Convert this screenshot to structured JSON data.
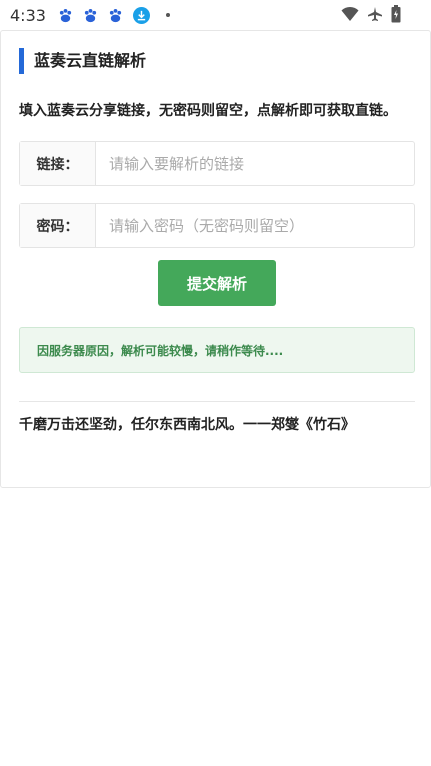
{
  "status_bar": {
    "time": "4:33",
    "left_icons": [
      "baidu-paw-icon",
      "baidu-paw-icon",
      "baidu-paw-icon",
      "download-icon",
      "dot-icon"
    ],
    "right_icons": [
      "wifi-icon",
      "airplane-icon",
      "battery-icon"
    ]
  },
  "card": {
    "title": "蓝奏云直链解析",
    "accent_color": "#2469d8",
    "intro": "填入蓝奏云分享链接，无密码则留空，点解析即可获取直链。",
    "link_field": {
      "label": "链接：",
      "placeholder": "请输入要解析的链接",
      "value": ""
    },
    "password_field": {
      "label": "密码：",
      "placeholder": "请输入密码（无密码则留空）",
      "value": ""
    },
    "submit_label": "提交解析",
    "submit_color": "#44a85a",
    "notice": "因服务器原因，解析可能较慢，请稍作等待....",
    "quote": "千磨万击还坚劲，任尔东西南北风。一一郑燮《竹石》"
  }
}
